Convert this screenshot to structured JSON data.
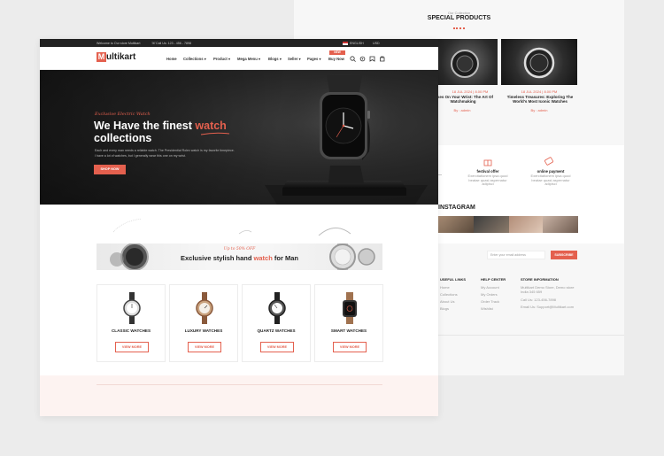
{
  "back": {
    "special": {
      "subtitle": "Our Collection",
      "title": "SPECIAL PRODUCTS"
    },
    "products": [
      {
        "date": "18 JUL 2024 | 8.00 PM",
        "name": "Takes On Your Wrist: The Art Of Watchmaking",
        "by": "By : admin"
      },
      {
        "date": "18 JUL 2024 | 8.00 PM",
        "name": "Timeless Treasures: Exploring The World's Most Iconic Watches",
        "by": "By : admin"
      }
    ],
    "services": [
      {
        "title": "festival offer",
        "desc": "Exercitationem ipsa quod beatae quasi aspernatur adipisci"
      },
      {
        "title": "online payment",
        "desc": "Exercitationem ipsa quod beatae quasi aspernatur adipisci"
      }
    ],
    "instagram": "INSTAGRAM",
    "newsletter": {
      "placeholder": "Enter your email address",
      "button": "SUBSCRIBE"
    },
    "footer": {
      "useful": {
        "title": "USEFUL LINKS",
        "links": [
          "Home",
          "Collections",
          "About Us",
          "Blogs"
        ]
      },
      "help": {
        "title": "HELP CENTER",
        "links": [
          "My Account",
          "My Orders",
          "Order Track",
          "Wishlist"
        ]
      },
      "store": {
        "title": "STORE INFORMATION",
        "lines": [
          "Multikart Demo Store, Demo store India 345 659",
          "Call Us: 123-456-7898",
          "Email Us: Support@Multikart.com"
        ]
      }
    }
  },
  "front": {
    "topbar": {
      "welcome": "Welcome to Our store Multikart",
      "phone": "Call Us: 123 - 456 - 7898",
      "language": "ENGLISH",
      "currency": "USD"
    },
    "logo": {
      "first": "M",
      "rest": "ultikart"
    },
    "nav": [
      {
        "label": "Home",
        "chev": ""
      },
      {
        "label": "Collections",
        "chev": "▾"
      },
      {
        "label": "Product",
        "chev": "▾"
      },
      {
        "label": "Mega Menu",
        "chev": "▾"
      },
      {
        "label": "Blogs",
        "chev": "▾"
      },
      {
        "label": "Seller",
        "chev": "▾"
      },
      {
        "label": "Pages",
        "chev": "▾"
      },
      {
        "label": "Buy Now",
        "chev": ""
      }
    ],
    "new_badge": "NEW",
    "hero": {
      "eyebrow": "Exclusive Electric Watch",
      "line1": "We Have the finest ",
      "highlight": "watch",
      "line2": "collections",
      "desc1": "Each and every man needs a reliable watch. The Presidential Rolex watch is my favorite timepiece.",
      "desc2": "I have a lot of watches, but I generally wear this one on my wrist.",
      "button": "SHOP NOW"
    },
    "banner": {
      "badge": "Up to 50% OFF",
      "pre": "Exclusive stylish hand ",
      "highlight": "watch",
      "post": " for Man"
    },
    "categories": [
      {
        "name": "CLASSIC WATCHES",
        "button": "VIEW MORE"
      },
      {
        "name": "LUXURY WATCHES",
        "button": "VIEW MORE"
      },
      {
        "name": "QUARTZ WATCHES",
        "button": "VIEW MORE"
      },
      {
        "name": "SMART WATCHES",
        "button": "VIEW MORE"
      }
    ]
  },
  "colors": {
    "accent": "#e4604e",
    "dark": "#222222",
    "page_bg": "#ececec"
  }
}
